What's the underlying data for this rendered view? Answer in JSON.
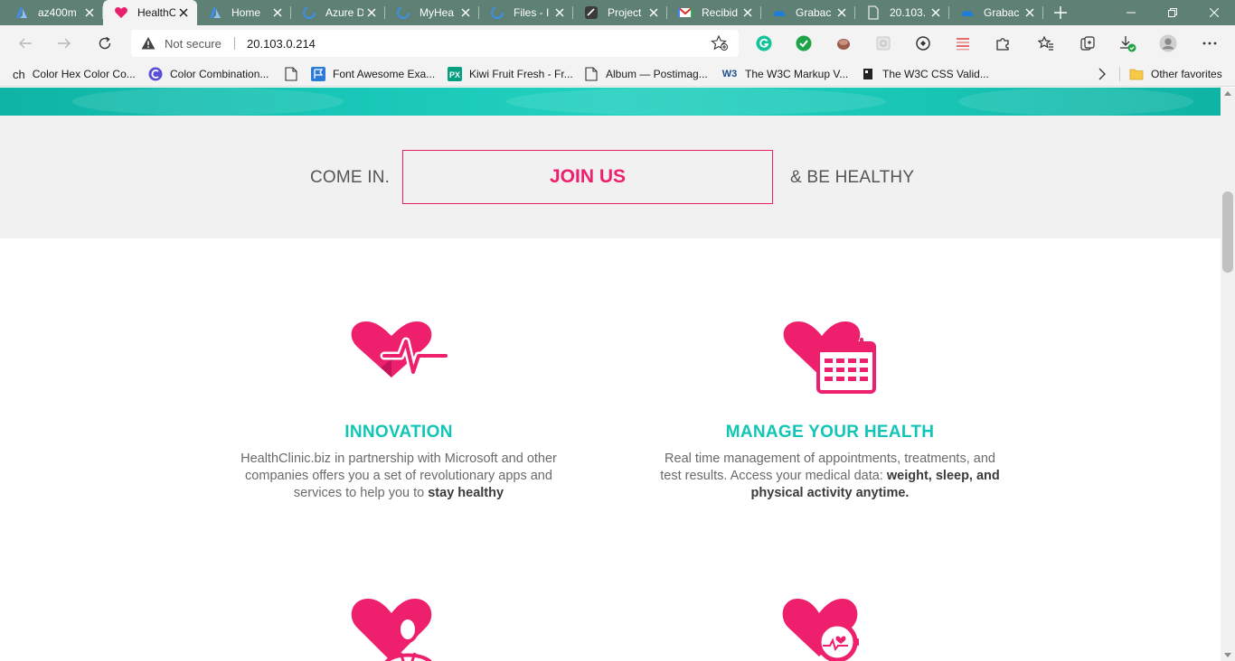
{
  "browser": {
    "tabs": [
      {
        "title": "az400m",
        "icon": "azure-devops-icon",
        "active": false
      },
      {
        "title": "HealthC",
        "icon": "heart-icon",
        "active": true
      },
      {
        "title": "Home",
        "icon": "azure-icon",
        "active": false
      },
      {
        "title": "Azure D",
        "icon": "loading-icon",
        "active": false
      },
      {
        "title": "MyHea",
        "icon": "loading-icon",
        "active": false
      },
      {
        "title": "Files - I",
        "icon": "loading-icon",
        "active": false
      },
      {
        "title": "Project",
        "icon": "project-icon",
        "active": false
      },
      {
        "title": "Recibid",
        "icon": "gmail-icon",
        "active": false
      },
      {
        "title": "Grabac",
        "icon": "onedrive-icon",
        "active": false
      },
      {
        "title": "20.103.",
        "icon": "page-icon",
        "active": false
      },
      {
        "title": "Grabac",
        "icon": "onedrive-icon",
        "active": false
      }
    ],
    "address": {
      "security_label": "Not secure",
      "url": "20.103.0.214"
    },
    "favorites": [
      {
        "label": "Color Hex Color Co...",
        "icon": "colorhex-icon"
      },
      {
        "label": "Color Combination...",
        "icon": "colorcombos-icon"
      },
      {
        "label": "Font Awesome Exa...",
        "icon": "page-icon"
      },
      {
        "label": "Kiwi Fruit Fresh - Fr...",
        "icon": "pexels-icon"
      },
      {
        "label": "Album — Postimag...",
        "icon": "page-icon"
      },
      {
        "label": "The W3C Markup V...",
        "icon": "w3c-icon"
      },
      {
        "label": "The W3C CSS Valid...",
        "icon": "w3c-css-icon"
      }
    ],
    "other_favorites": "Other favorites",
    "favicon_prefix": "ch"
  },
  "page": {
    "join": {
      "lead": "COME IN.",
      "button": "JOIN US",
      "tail": "& BE HEALTHY"
    },
    "features": [
      {
        "title": "INNOVATION",
        "text_plain": "HealthClinic.biz in partnership with Microsoft and other companies offers you a set of revolutionary apps and services to help you to ",
        "text_bold": "stay healthy",
        "icon": "heart-pulse-icon"
      },
      {
        "title": "MANAGE YOUR HEALTH",
        "text_plain": "Real time management of appointments, treatments, and test results. Access your medical data: ",
        "text_bold": "weight, sleep, and physical activity anytime.",
        "icon": "heart-calendar-icon"
      }
    ],
    "lower_icons": [
      "heart-doctor-icon",
      "heart-watch-icon"
    ]
  },
  "colors": {
    "brand_pink": "#ee1f6c",
    "brand_teal": "#11c6b6",
    "tab_strip": "#5f8074"
  }
}
